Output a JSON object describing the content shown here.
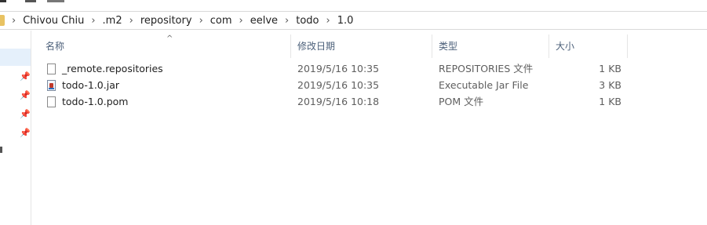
{
  "breadcrumb": [
    "Chivou Chiu",
    ".m2",
    "repository",
    "com",
    "eelve",
    "todo",
    "1.0"
  ],
  "columns": {
    "name": "名称",
    "date": "修改日期",
    "type": "类型",
    "size": "大小"
  },
  "files": [
    {
      "name": "_remote.repositories",
      "date": "2019/5/16 10:35",
      "type": "REPOSITORIES 文件",
      "size": "1 KB",
      "icon": "file-icon"
    },
    {
      "name": "todo-1.0.jar",
      "date": "2019/5/16 10:35",
      "type": "Executable Jar File",
      "size": "3 KB",
      "icon": "jar-file-icon"
    },
    {
      "name": "todo-1.0.pom",
      "date": "2019/5/16 10:18",
      "type": "POM 文件",
      "size": "1 KB",
      "icon": "file-icon"
    }
  ]
}
